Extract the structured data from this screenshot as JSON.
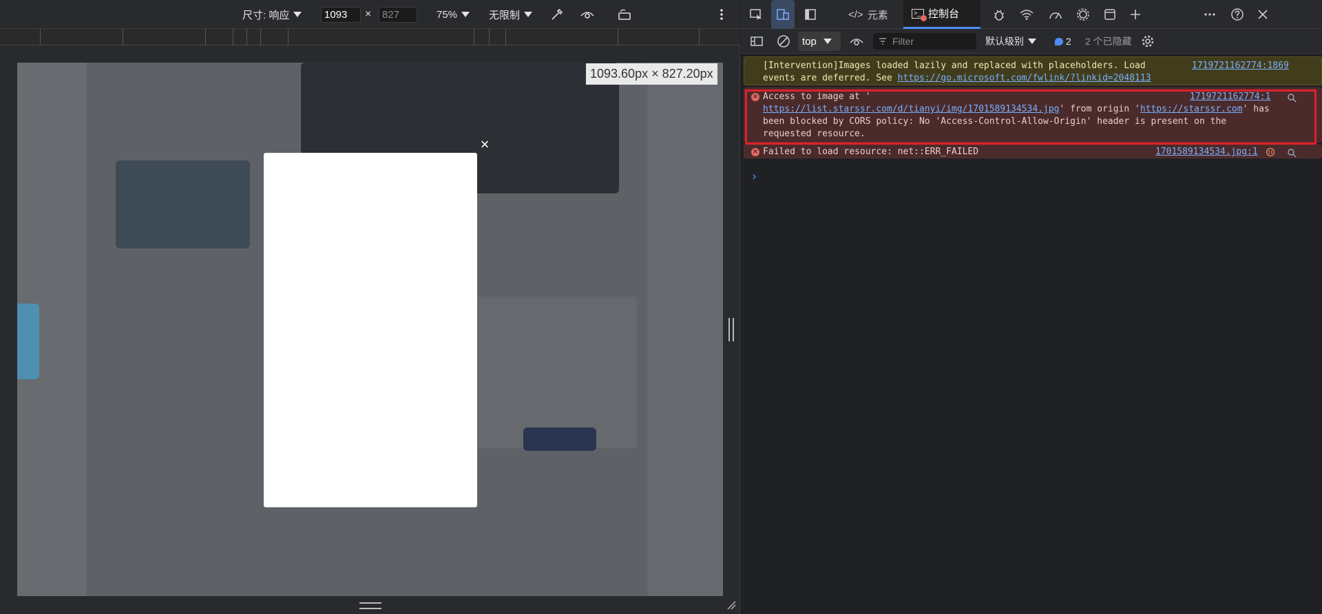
{
  "device_toolbar": {
    "size_label": "尺寸: 响应",
    "width_value": "1093",
    "times": "×",
    "height_placeholder": "827",
    "zoom": "75%",
    "throttle": "无限制"
  },
  "viewport": {
    "size_readout": "1093.60px × 827.20px",
    "modal_close": "×"
  },
  "devtools_tabs": {
    "elements": "元素",
    "console": "控制台"
  },
  "console_toolbar": {
    "context": "top",
    "filter_placeholder": "Filter",
    "level": "默认级别",
    "issues_count": "2",
    "hidden": "2 个已隐藏"
  },
  "messages": {
    "warning": {
      "text1": "[Intervention]Images loaded lazily and replaced with placeholders. Load",
      "text2": "events are deferred. See ",
      "link": "https://go.microsoft.com/fwlink/?linkid=2048113",
      "source": "1719721162774:1869"
    },
    "error1": {
      "line1": "Access to image at '",
      "url": "https://list.starssr.com/d/tianyi/img/1701589134534.jpg",
      "mid": "' from origin '",
      "origin": "https://starssr.com",
      "end": "' has",
      "line3": "been blocked by CORS policy: No 'Access-Control-Allow-Origin' header is present on the",
      "line4": "requested resource.",
      "source": "1719721162774:1"
    },
    "error2": {
      "text": "Failed to load resource: net::ERR_FAILED",
      "source": "1701589134534.jpg:1"
    }
  },
  "colors": {
    "accent": "#4d8df7",
    "error_outline": "#e0202c",
    "warning_bg": "#413d1c",
    "error_bg": "#4a2a2a"
  }
}
